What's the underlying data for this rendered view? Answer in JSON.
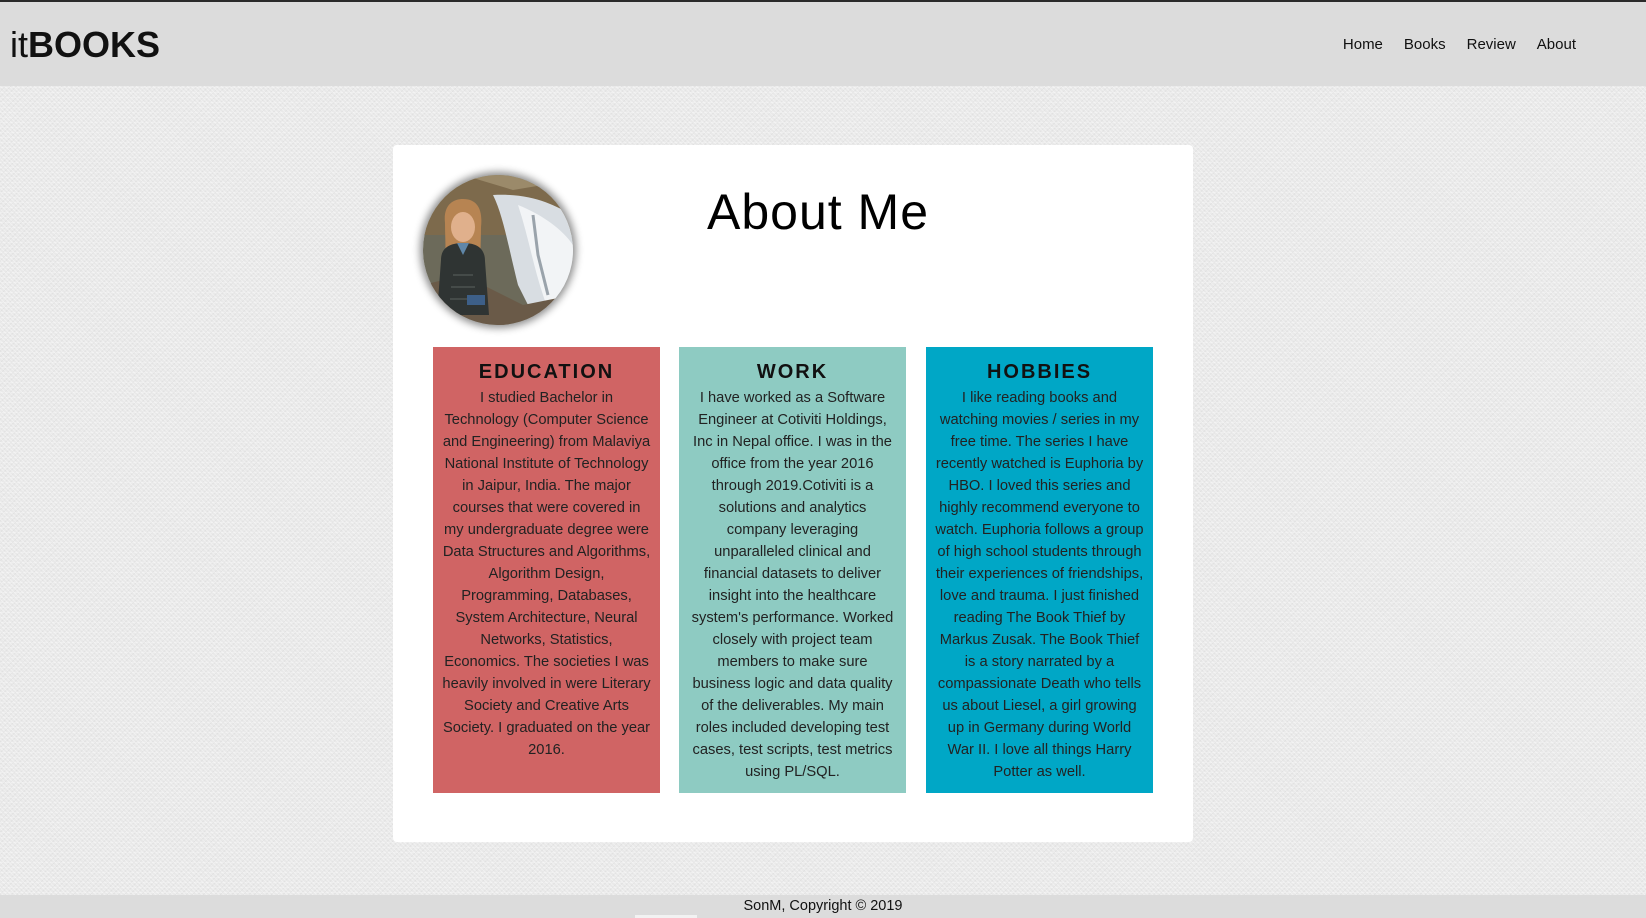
{
  "brand": {
    "light": "it",
    "bold": "BOOKS"
  },
  "nav": {
    "home": "Home",
    "books": "Books",
    "review": "Review",
    "about": "About"
  },
  "page": {
    "title": "About Me"
  },
  "sections": {
    "education": {
      "heading": "EDUCATION",
      "text": "I studied Bachelor in Technology (Computer Science and Engineering) from Malaviya National Institute of Technology in Jaipur, India. The major courses that were covered in my undergraduate degree were Data Structures and Algorithms, Algorithm Design, Programming, Databases, System Architecture, Neural Networks, Statistics, Economics. The societies I was heavily involved in were Literary Society and Creative Arts Society. I graduated on the year 2016.",
      "color": "#d06464"
    },
    "work": {
      "heading": "WORK",
      "text": "I have worked as a Software Engineer at Cotiviti Holdings, Inc in Nepal office. I was in the office from the year 2016 through 2019.Cotiviti is a solutions and analytics company leveraging unparalleled clinical and financial datasets to deliver insight into the healthcare system's performance. Worked closely with project team members to make sure business logic and data quality of the deliverables. My main roles included developing test cases, test scripts, test metrics using PL/SQL.",
      "color": "#8ecbc2"
    },
    "hobbies": {
      "heading": "HOBBIES",
      "text": "I like reading books and watching movies / series in my free time. The series I have recently watched is Euphoria by HBO. I loved this series and highly recommend everyone to watch. Euphoria follows a group of high school students through their experiences of friendships, love and trauma. I just finished reading The Book Thief by Markus Zusak. The Book Thief is a story narrated by a compassionate Death who tells us about Liesel, a girl growing up in Germany during World War II. I love all things Harry Potter as well.",
      "color": "#00a7c6"
    }
  },
  "footer": {
    "text": "SonM, Copyright © 2019"
  }
}
